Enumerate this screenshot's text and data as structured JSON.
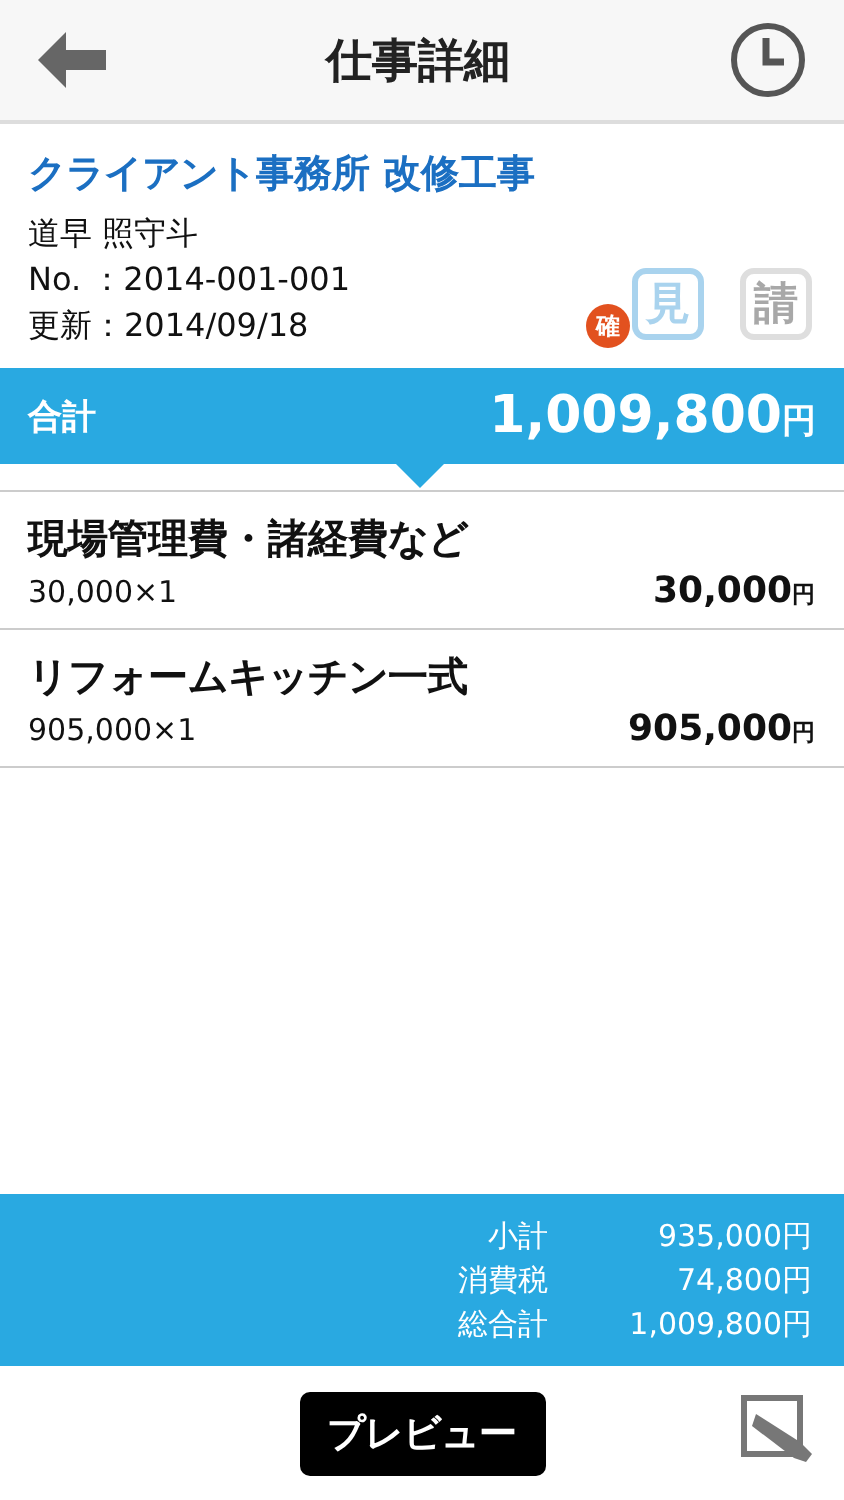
{
  "header": {
    "title": "仕事詳細"
  },
  "job": {
    "title": "クライアント事務所 改修工事",
    "client": "道早 照守斗",
    "number": "No. ：2014-001-001",
    "updated": "更新：2014/09/18"
  },
  "documents": [
    {
      "label": "見",
      "active": true,
      "stamp": "確"
    },
    {
      "label": "請",
      "active": false
    }
  ],
  "total": {
    "label": "合計",
    "amount": "1,009,800",
    "unit": "円"
  },
  "items": [
    {
      "name": "現場管理費・諸経費など",
      "quantity": "30,000×1",
      "amount": "30,000",
      "unit": "円"
    },
    {
      "name": "リフォームキッチン一式",
      "quantity": "905,000×1",
      "amount": "905,000",
      "unit": "円"
    }
  ],
  "summary": [
    {
      "label": "小計",
      "value": "935,000円"
    },
    {
      "label": "消費税",
      "value": "74,800円"
    },
    {
      "label": "総合計",
      "value": "1,009,800円"
    }
  ],
  "preview_button": "プレビュー"
}
